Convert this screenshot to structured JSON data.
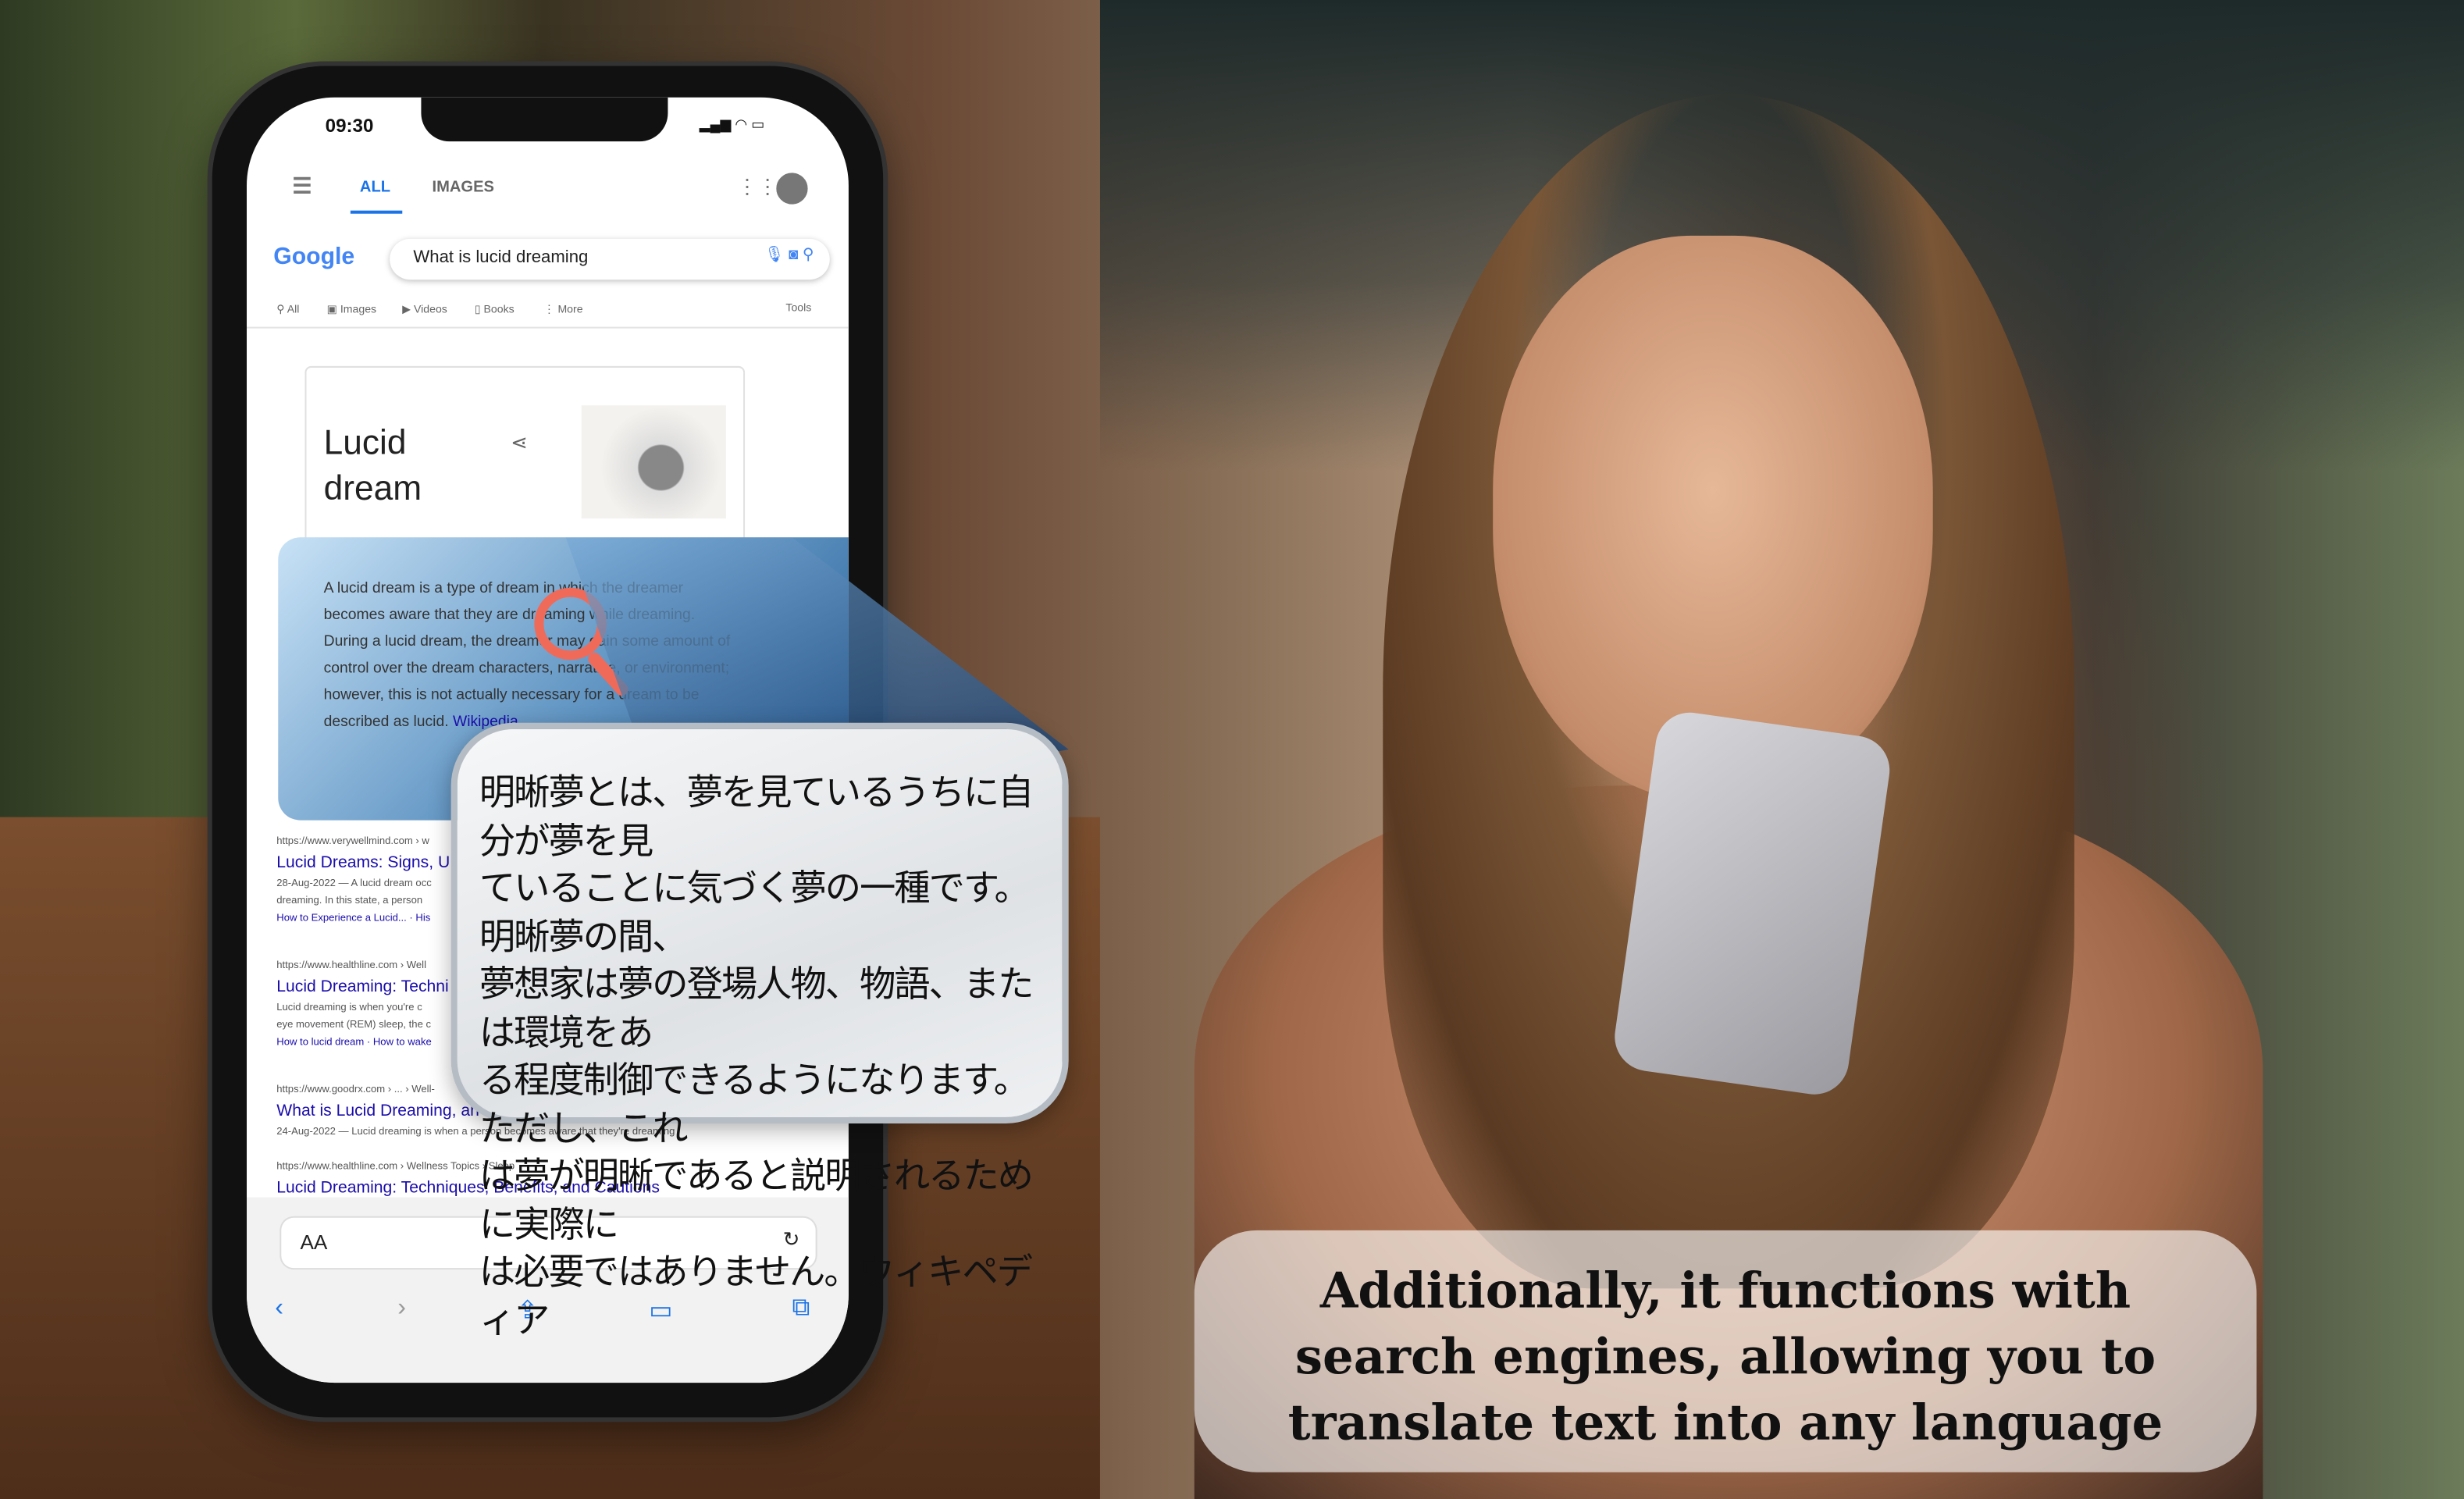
{
  "status_bar": {
    "time": "09:30"
  },
  "google": {
    "tabs": [
      "ALL",
      "IMAGES"
    ],
    "logo": "Google",
    "query": "What is lucid dreaming",
    "filters": [
      "All",
      "Images",
      "Videos",
      "Books",
      "More"
    ],
    "tools": "Tools"
  },
  "knowledge_panel": {
    "title_line1": "Lucid",
    "title_line2": "dream",
    "description": "A lucid dream is a type of dream in which the dreamer becomes aware that they are dreaming while dreaming. During a lucid dream, the dreamer may gain some amount of control over the dream characters, narrative, or environment; however, this is not actually necessary for a dream to be described as lucid.",
    "source": "Wikipedia"
  },
  "results": [
    {
      "url": "https://www.verywellmind.com › w",
      "title": "Lucid Dreams: Signs, U",
      "snippet1": "28-Aug-2022 — A lucid dream occ",
      "snippet2": "dreaming. In this state, a person",
      "links": "How to Experience a Lucid... · His"
    },
    {
      "url": "https://www.healthline.com › Well",
      "title": "Lucid Dreaming: Techni",
      "snippet1": "Lucid dreaming is when you're c",
      "snippet2": "eye movement (REM) sleep, the c",
      "links": "How to lucid dream · How to wake"
    },
    {
      "url": "https://www.goodrx.com › ... › Well-",
      "title": "What is Lucid Dreaming, an",
      "snippet1": "24-Aug-2022 — Lucid dreaming is when a person becomes aware that they're dreaming"
    },
    {
      "url": "https://www.healthline.com › Wellness Topics › Sleep",
      "title": "Lucid Dreaming: Techniques, Benefits, and Cautions"
    }
  ],
  "translation": {
    "lines": [
      "明晰夢とは、夢を見ているうちに自分が夢を見",
      "ていることに気づく夢の一種です。明晰夢の間、",
      "夢想家は夢の登場人物、物語、または環境をあ",
      "る程度制御できるようになります。ただし、これ",
      "は夢が明晰であると説明されるために実際に",
      "は必要ではありません。ウィキペディア"
    ]
  },
  "browser": {
    "address_label": "AA"
  },
  "caption": {
    "lines": [
      "Additionally, it functions with",
      "search engines, allowing you to",
      "translate text into any language"
    ]
  },
  "colors": {
    "accent": "#1a73e8",
    "link": "#1a0dab",
    "magnifier": "#f06a5a"
  }
}
